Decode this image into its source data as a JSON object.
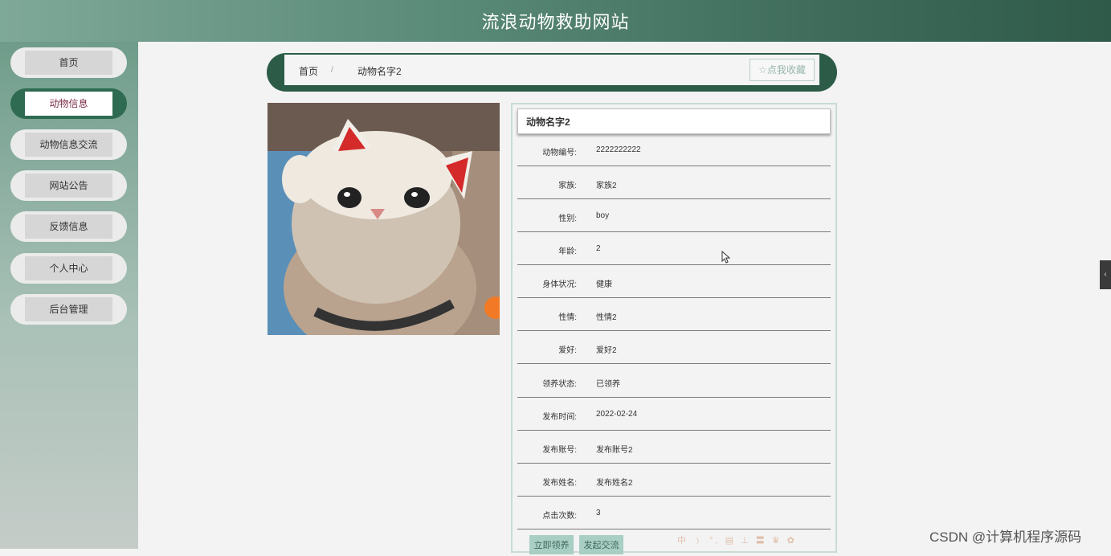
{
  "header": {
    "title": "流浪动物救助网站"
  },
  "sidebar": {
    "items": [
      {
        "label": "首页"
      },
      {
        "label": "动物信息"
      },
      {
        "label": "动物信息交流"
      },
      {
        "label": "网站公告"
      },
      {
        "label": "反馈信息"
      },
      {
        "label": "个人中心"
      },
      {
        "label": "后台管理"
      }
    ],
    "active_label": "动物信息"
  },
  "breadcrumb": {
    "home": "首页",
    "separator": "/",
    "current": "动物名字2"
  },
  "favorite_button": {
    "label": "☆点我收藏"
  },
  "detail": {
    "title": "动物名字2",
    "fields": [
      {
        "label": "动物编号:",
        "value": "2222222222"
      },
      {
        "label": "家族:",
        "value": "家族2"
      },
      {
        "label": "性别:",
        "value": "boy"
      },
      {
        "label": "年龄:",
        "value": "2"
      },
      {
        "label": "身体状况:",
        "value": "健康"
      },
      {
        "label": "性情:",
        "value": "性情2"
      },
      {
        "label": "爱好:",
        "value": "爱好2"
      },
      {
        "label": "领养状态:",
        "value": "已领养"
      },
      {
        "label": "发布时间:",
        "value": "2022-02-24"
      },
      {
        "label": "发布账号:",
        "value": "发布账号2"
      },
      {
        "label": "发布姓名:",
        "value": "发布姓名2"
      },
      {
        "label": "点击次数:",
        "value": "3"
      }
    ],
    "buttons": {
      "adopt": "立即领养",
      "discuss": "发起交流"
    }
  },
  "colors": {
    "header_start": "#7fa898",
    "header_end": "#2f5a4a",
    "accent": "#2c5c48",
    "active_text": "#7a2b48"
  },
  "watermark": "CSDN @计算机程序源码",
  "ime_toolbar": "中 ﹚ °, ▤ ⊥ 〓 ♛ ✿"
}
